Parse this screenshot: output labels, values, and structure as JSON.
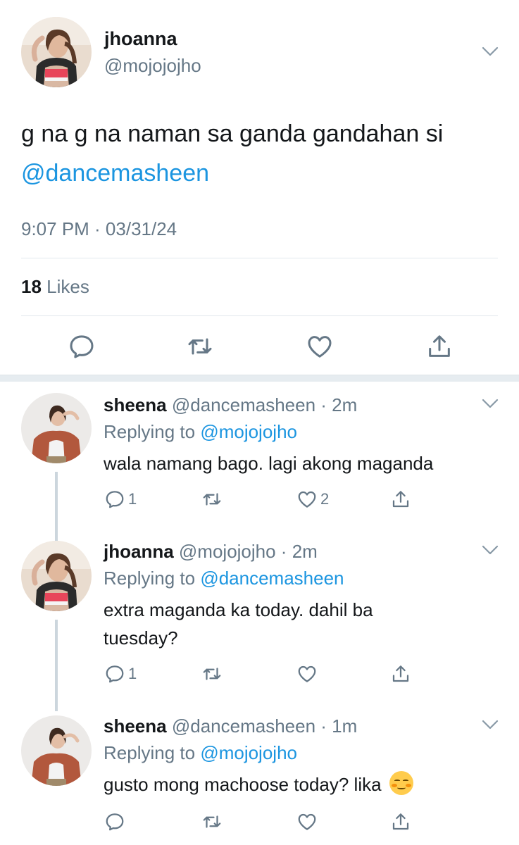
{
  "main_tweet": {
    "name": "jhoanna",
    "handle": "@mojojojho",
    "text_prefix": "g na g na naman sa ganda gandahan si",
    "mention": "@dancemasheen",
    "timestamp": "9:07 PM · 03/31/24",
    "likes_count": "18",
    "likes_label": "Likes"
  },
  "replies": [
    {
      "name": "sheena",
      "meta": "@dancemasheen · 2m",
      "replying_label": "Replying to",
      "replying_to": "@mojojojho",
      "text": "wala namang bago. lagi akong maganda",
      "reply_count": "1",
      "like_count": "2"
    },
    {
      "name": "jhoanna",
      "meta": "@mojojojho · 2m",
      "replying_label": "Replying to",
      "replying_to": "@dancemasheen",
      "text": "extra maganda ka today. dahil ba tuesday?",
      "reply_count": "1",
      "like_count": ""
    },
    {
      "name": "sheena",
      "meta": "@dancemasheen · 1m",
      "replying_label": "Replying to",
      "replying_to": "@mojojojho",
      "text": "gusto mong machoose today? lika",
      "reply_count": "",
      "like_count": ""
    }
  ],
  "colors": {
    "mention": "#1b95e0",
    "secondary_text": "#657786",
    "icon": "#657786",
    "divider": "#e1e8ed",
    "thread_line": "#ccd6dd"
  },
  "icons": [
    "chevron-down-icon",
    "reply-icon",
    "retweet-icon",
    "like-icon",
    "share-icon",
    "relieved-face-emoji"
  ]
}
